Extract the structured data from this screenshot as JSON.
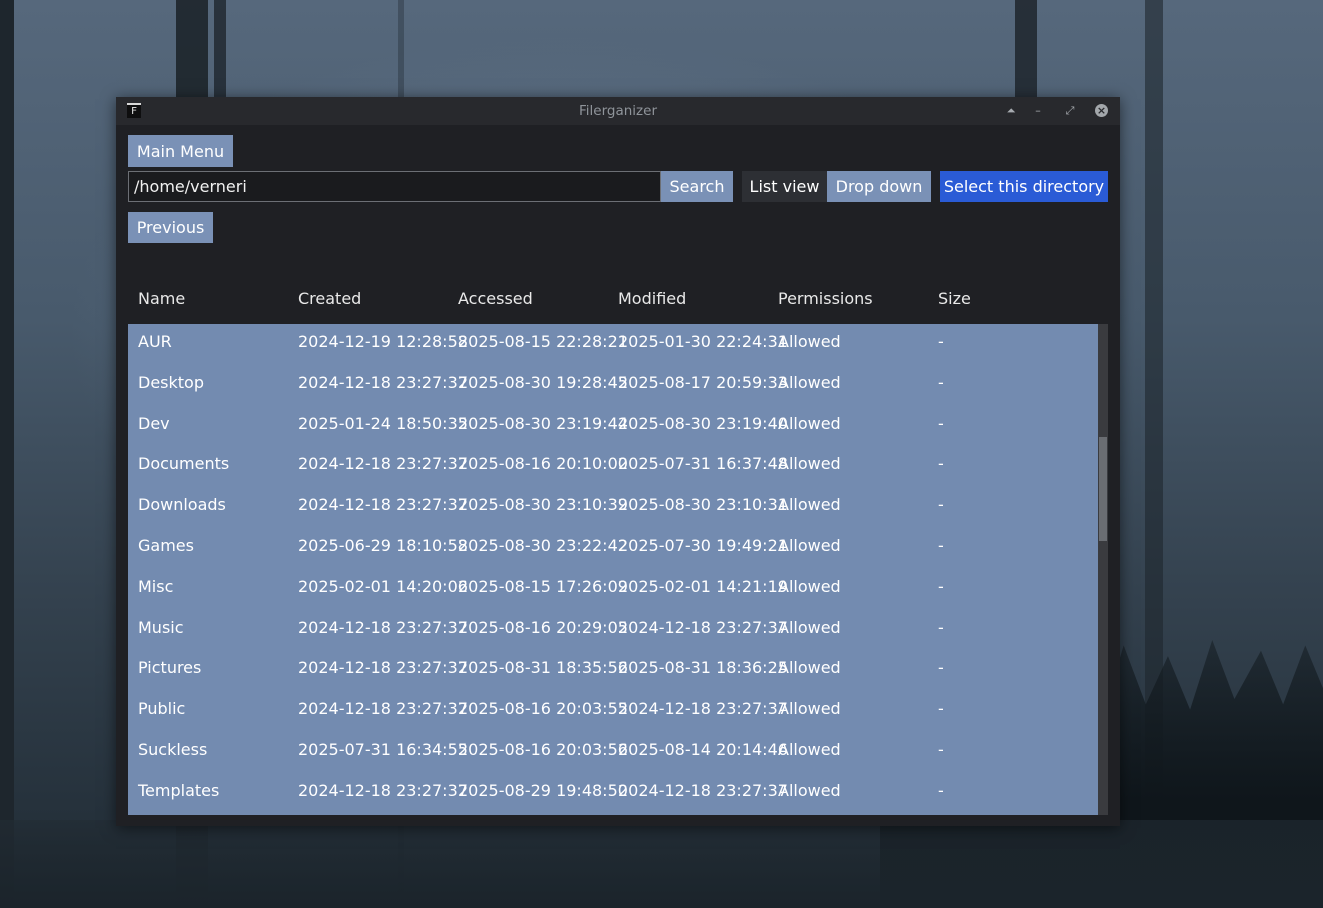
{
  "window": {
    "title": "Filerganizer",
    "app_icon_letter": "F",
    "controls": {
      "shade": "⏶",
      "minimize": "–",
      "maximize": "⤢",
      "close": "×"
    }
  },
  "toolbar": {
    "main_menu_label": "Main Menu",
    "path_value": "/home/verneri",
    "search_label": "Search",
    "list_view_label": "List view",
    "drop_down_label": "Drop down",
    "select_directory_label": "Select this directory",
    "previous_label": "Previous"
  },
  "table": {
    "headers": [
      "Name",
      "Created",
      "Accessed",
      "Modified",
      "Permissions",
      "Size"
    ],
    "rows": [
      [
        "AUR",
        "2024-12-19 12:28:58",
        "2025-08-15 22:28:21",
        "2025-01-30 22:24:31",
        "Allowed",
        "-"
      ],
      [
        "Desktop",
        "2024-12-18 23:27:37",
        "2025-08-30 19:28:45",
        "2025-08-17 20:59:33",
        "Allowed",
        "-"
      ],
      [
        "Dev",
        "2025-01-24 18:50:35",
        "2025-08-30 23:19:44",
        "2025-08-30 23:19:40",
        "Allowed",
        "-"
      ],
      [
        "Documents",
        "2024-12-18 23:27:37",
        "2025-08-16 20:10:00",
        "2025-07-31 16:37:48",
        "Allowed",
        "-"
      ],
      [
        "Downloads",
        "2024-12-18 23:27:37",
        "2025-08-30 23:10:39",
        "2025-08-30 23:10:31",
        "Allowed",
        "-"
      ],
      [
        "Games",
        "2025-06-29 18:10:58",
        "2025-08-30 23:22:42",
        "2025-07-30 19:49:21",
        "Allowed",
        "-"
      ],
      [
        "Misc",
        "2025-02-01 14:20:06",
        "2025-08-15 17:26:09",
        "2025-02-01 14:21:19",
        "Allowed",
        "-"
      ],
      [
        "Music",
        "2024-12-18 23:27:37",
        "2025-08-16 20:29:05",
        "2024-12-18 23:27:37",
        "Allowed",
        "-"
      ],
      [
        "Pictures",
        "2024-12-18 23:27:37",
        "2025-08-31 18:35:56",
        "2025-08-31 18:36:25",
        "Allowed",
        "-"
      ],
      [
        "Public",
        "2024-12-18 23:27:37",
        "2025-08-16 20:03:55",
        "2024-12-18 23:27:37",
        "Allowed",
        "-"
      ],
      [
        "Suckless",
        "2025-07-31 16:34:55",
        "2025-08-16 20:03:56",
        "2025-08-14 20:14:46",
        "Allowed",
        "-"
      ],
      [
        "Templates",
        "2024-12-18 23:27:37",
        "2025-08-29 19:48:50",
        "2024-12-18 23:27:37",
        "Allowed",
        "-"
      ]
    ]
  },
  "colors": {
    "accent": "#2a5bd6",
    "row_background": "#738bb0",
    "window_background": "#1f2024"
  }
}
